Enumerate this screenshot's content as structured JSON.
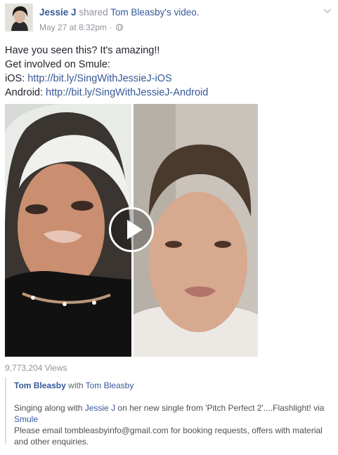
{
  "post": {
    "author": "Jessie J",
    "action": "shared",
    "source_name": "Tom Bleasby",
    "source_suffix": "'s video.",
    "date": "May 27 at 8:32pm",
    "separator": "·",
    "audience_icon": "globe-icon",
    "menu_icon": "chevron-down-icon"
  },
  "message": {
    "line1": "Have you seen this? It's amazing!!",
    "line2": "Get involved on Smule:",
    "ios_label": "iOS: ",
    "ios_link": "http://bit.ly/SingWithJessieJ-iOS",
    "android_label": "Android: ",
    "android_link": "http://bit.ly/SingWithJessieJ-Android"
  },
  "video": {
    "play_icon": "play-icon",
    "views": "9,773,204 Views"
  },
  "shared_post": {
    "author": "Tom Bleasby",
    "with_word": "with",
    "with_name": "Tom Bleasby",
    "desc_part1": "Singing along with ",
    "desc_mention": "Jessie J",
    "desc_part2": " on her new single from 'Pitch Perfect 2'....Flashlight! via",
    "desc_link": "Smule",
    "email_line1": "Please email tombleasbyinfo@gmail.com for booking requests, offers with material",
    "email_line2": "and other enquiries."
  },
  "colors": {
    "link": "#365899",
    "muted": "#90949c",
    "text": "#1d2129",
    "border": "#dddfe2"
  }
}
